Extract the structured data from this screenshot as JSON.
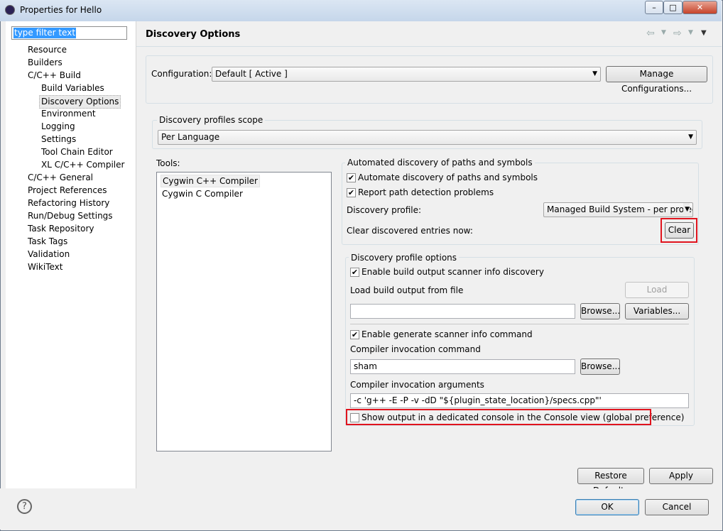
{
  "window": {
    "title": "Properties for Hello",
    "controls": {
      "minimize": "–",
      "maximize": "□",
      "close": "✕"
    }
  },
  "nav": {
    "filter_value": "type filter text",
    "items": [
      "Resource",
      "Builders",
      "C/C++ Build",
      "Build Variables",
      "Discovery Options",
      "Environment",
      "Logging",
      "Settings",
      "Tool Chain Editor",
      "XL C/C++ Compiler",
      "C/C++ General",
      "Project References",
      "Refactoring History",
      "Run/Debug Settings",
      "Task Repository",
      "Task Tags",
      "Validation",
      "WikiText"
    ],
    "selected": "Discovery Options"
  },
  "header": {
    "title": "Discovery Options",
    "back_icon": "arrow-left-icon",
    "forward_icon": "arrow-right-icon",
    "menu_icon": "chevron-down-icon"
  },
  "configuration": {
    "label": "Configuration:",
    "value": "Default  [ Active ]",
    "manage_button": "Manage Configurations..."
  },
  "scope": {
    "group_label": "Discovery profiles scope",
    "value": "Per Language"
  },
  "tools": {
    "label": "Tools:",
    "items": [
      "Cygwin C++ Compiler",
      "Cygwin C Compiler"
    ],
    "selected": "Cygwin C++ Compiler"
  },
  "automated": {
    "group_label": "Automated discovery of paths and symbols",
    "automate_label": "Automate discovery of paths and symbols",
    "automate_checked": true,
    "report_label": "Report path detection problems",
    "report_checked": true,
    "profile_label": "Discovery profile:",
    "profile_value": "Managed Build System - per project",
    "clear_label": "Clear discovered entries now:",
    "clear_button": "Clear"
  },
  "profile_options": {
    "group_label": "Discovery profile options",
    "enable_scanner_label": "Enable build output scanner info discovery",
    "enable_scanner_checked": true,
    "load_label": "Load build output from file",
    "load_button": "Load",
    "load_input": "",
    "browse_button": "Browse...",
    "variables_button": "Variables...",
    "enable_generate_label": "Enable generate scanner info command",
    "enable_generate_checked": true,
    "invocation_command_label": "Compiler invocation command",
    "invocation_command_value": "sham",
    "browse2_button": "Browse...",
    "invocation_args_label": "Compiler invocation arguments",
    "invocation_args_value": "-c 'g++ -E -P -v -dD \"${plugin_state_location}/specs.cpp\"'",
    "show_output_label": "Show output in a dedicated console in the Console view (global preference)",
    "show_output_checked": false
  },
  "buttons": {
    "restore_defaults": "Restore Defaults",
    "apply": "Apply",
    "ok": "OK",
    "cancel": "Cancel",
    "help_icon": "help-icon"
  },
  "colors": {
    "highlight_box": "#e0141e",
    "selection": "#3399ff"
  }
}
